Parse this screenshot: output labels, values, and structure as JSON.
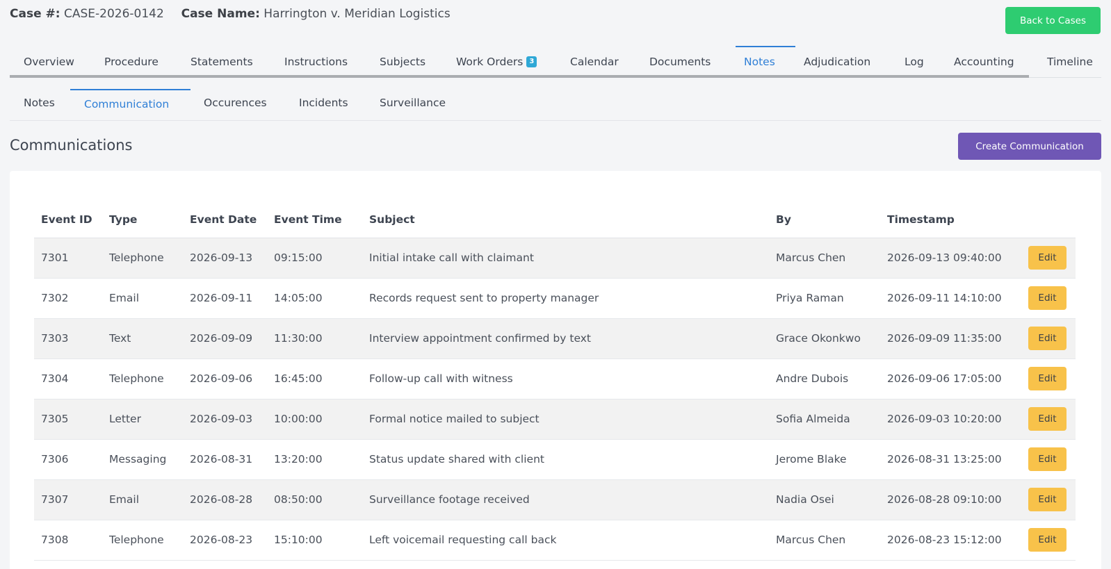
{
  "header": {
    "case_number_label": "Case #:",
    "case_number": "CASE-2026-0142",
    "case_name_label": "Case Name:",
    "case_name": "Harrington v. Meridian Logistics",
    "back_button": "Back to Cases"
  },
  "main_tabs": [
    {
      "label": "Overview"
    },
    {
      "label": "Procedure"
    },
    {
      "label": "Statements"
    },
    {
      "label": "Instructions"
    },
    {
      "label": "Subjects"
    },
    {
      "label": "Work Orders",
      "badge": "3"
    },
    {
      "label": "Calendar"
    },
    {
      "label": "Documents"
    },
    {
      "label": "Notes",
      "active": true
    },
    {
      "label": "Adjudication"
    },
    {
      "label": "Log"
    },
    {
      "label": "Accounting"
    },
    {
      "label": "Timeline"
    }
  ],
  "sub_tabs": [
    {
      "label": "Notes"
    },
    {
      "label": "Communication",
      "active": true
    },
    {
      "label": "Occurences"
    },
    {
      "label": "Incidents"
    },
    {
      "label": "Surveillance"
    }
  ],
  "section": {
    "title": "Communications",
    "create_button": "Create Communication"
  },
  "table": {
    "columns": [
      "Event ID",
      "Type",
      "Event Date",
      "Event Time",
      "Subject",
      "By",
      "Timestamp",
      ""
    ],
    "edit_label": "Edit",
    "rows": [
      [
        "7301",
        "Telephone",
        "2026-09-13",
        "09:15:00",
        "Initial intake call with claimant",
        "Marcus Chen",
        "2026-09-13 09:40:00"
      ],
      [
        "7302",
        "Email",
        "2026-09-11",
        "14:05:00",
        "Records request sent to property manager",
        "Priya Raman",
        "2026-09-11 14:10:00"
      ],
      [
        "7303",
        "Text",
        "2026-09-09",
        "11:30:00",
        "Interview appointment confirmed by text",
        "Grace Okonkwo",
        "2026-09-09 11:35:00"
      ],
      [
        "7304",
        "Telephone",
        "2026-09-06",
        "16:45:00",
        "Follow-up call with witness",
        "Andre Dubois",
        "2026-09-06 17:05:00"
      ],
      [
        "7305",
        "Letter",
        "2026-09-03",
        "10:00:00",
        "Formal notice mailed to subject",
        "Sofia Almeida",
        "2026-09-03 10:20:00"
      ],
      [
        "7306",
        "Messaging",
        "2026-08-31",
        "13:20:00",
        "Status update shared with client",
        "Jerome Blake",
        "2026-08-31 13:25:00"
      ],
      [
        "7307",
        "Email",
        "2026-08-28",
        "08:50:00",
        "Surveillance footage received",
        "Nadia Osei",
        "2026-08-28 09:10:00"
      ],
      [
        "7308",
        "Telephone",
        "2026-08-23",
        "15:10:00",
        "Left voicemail requesting call back",
        "Marcus Chen",
        "2026-08-23 15:12:00"
      ]
    ]
  },
  "colors": {
    "accent_blue": "#2f7fd6",
    "back_button_green": "#2ecc71",
    "create_button_purple": "#6f57b5",
    "edit_button_yellow": "#f8c24a",
    "badge_cyan": "#2fa8d6"
  }
}
